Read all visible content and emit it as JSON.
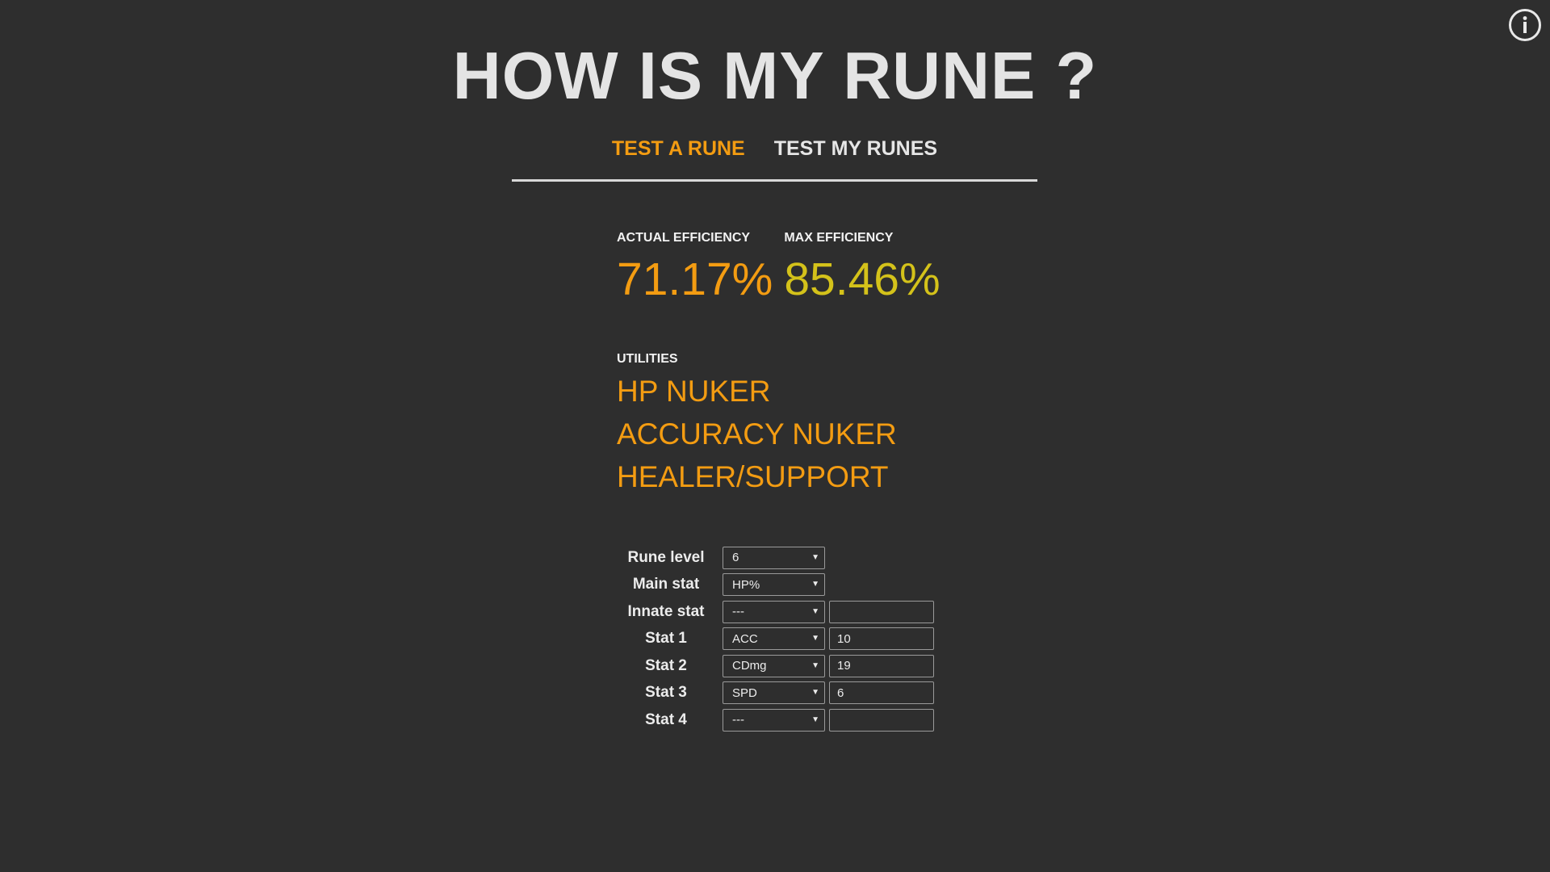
{
  "header": {
    "title": "HOW IS MY RUNE ?",
    "info_icon": "info-circle-icon"
  },
  "tabs": [
    {
      "label": "TEST A RUNE",
      "active": true
    },
    {
      "label": "TEST MY RUNES",
      "active": false
    }
  ],
  "efficiency": {
    "actual_label": "ACTUAL EFFICIENCY",
    "actual_value": "71.17%",
    "max_label": "MAX EFFICIENCY",
    "max_value": "85.46%"
  },
  "utilities": {
    "label": "UTILITIES",
    "items": [
      "HP NUKER",
      "ACCURACY NUKER",
      "HEALER/SUPPORT"
    ]
  },
  "form": {
    "rows": [
      {
        "label": "Rune level",
        "select": "6",
        "value": null
      },
      {
        "label": "Main stat",
        "select": "HP%",
        "value": null
      },
      {
        "label": "Innate stat",
        "select": "---",
        "value": ""
      },
      {
        "label": "Stat 1",
        "select": "ACC",
        "value": "10"
      },
      {
        "label": "Stat 2",
        "select": "CDmg",
        "value": "19"
      },
      {
        "label": "Stat 3",
        "select": "SPD",
        "value": "6"
      },
      {
        "label": "Stat 4",
        "select": "---",
        "value": ""
      }
    ],
    "caret_glyph": "▼"
  },
  "colors": {
    "background": "#2e2e2e",
    "accent_orange": "#f39c12",
    "accent_yellow": "#d4c21a",
    "text": "#ececec"
  }
}
